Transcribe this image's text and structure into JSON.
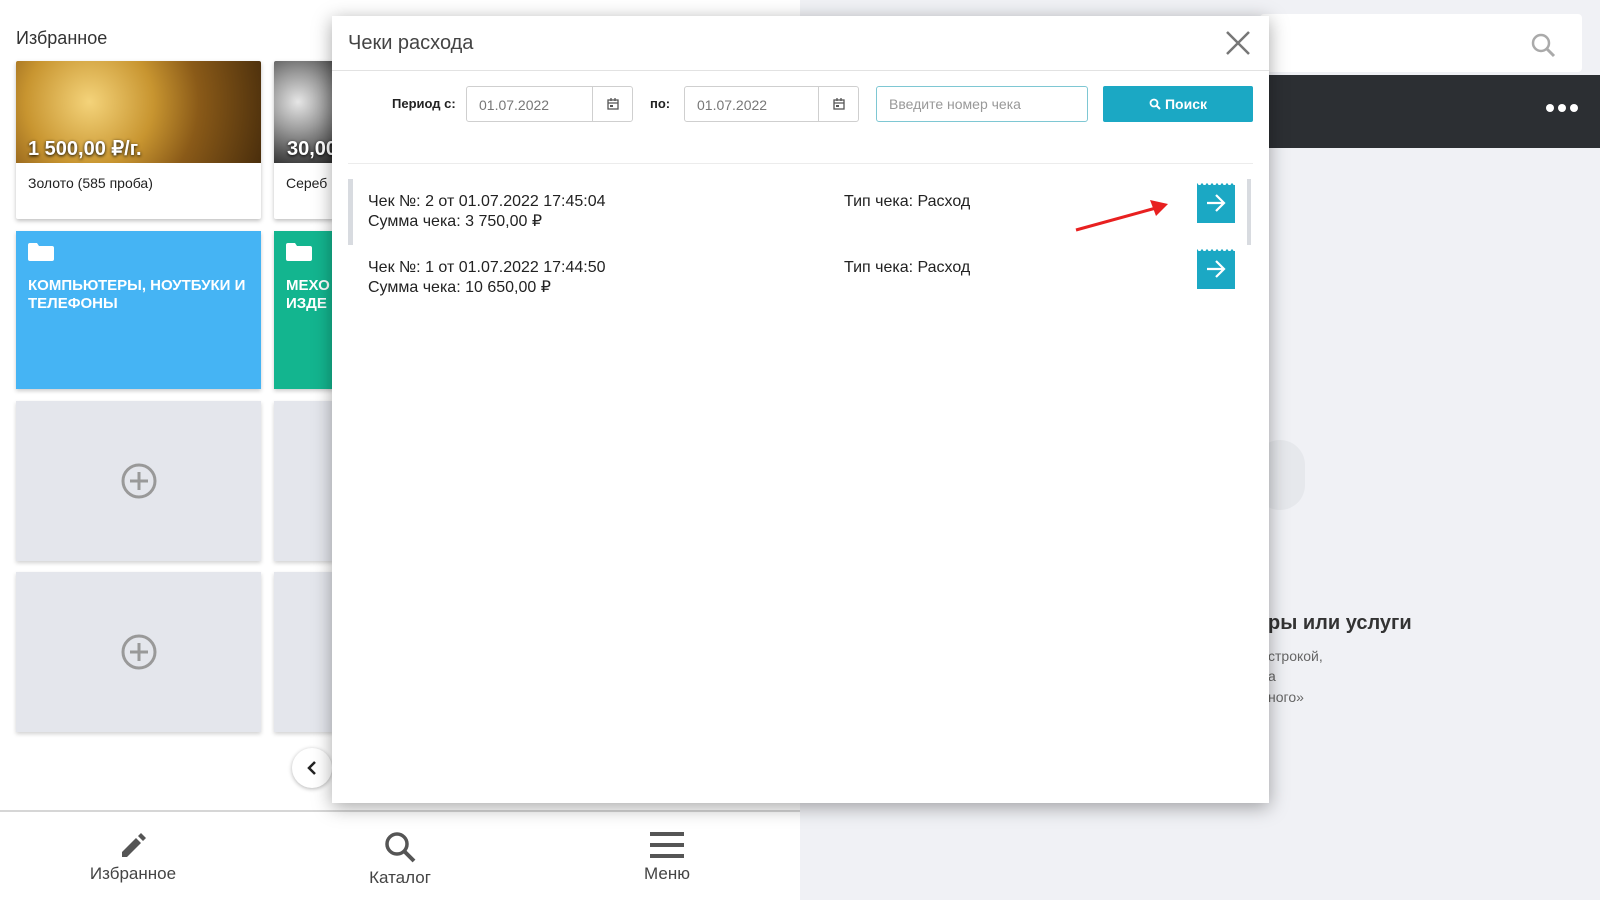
{
  "favorites": {
    "title": "Избранное",
    "products": [
      {
        "price": "1 500,00 ₽/г.",
        "name": "Золото (585 проба)"
      },
      {
        "price": "30,00",
        "name": "Сереб"
      }
    ],
    "categories": [
      {
        "label": "КОМПЬЮТЕРЫ, НОУТБУКИ И ТЕЛЕФОНЫ",
        "color": "#45b4f4"
      },
      {
        "label": "МЕХО ИЗДЕ",
        "color": "#13b58f"
      }
    ]
  },
  "bottom_nav": [
    {
      "label": "Избранное",
      "icon": "pencil-icon"
    },
    {
      "label": "Каталог",
      "icon": "search-icon"
    },
    {
      "label": "Меню",
      "icon": "hamburger-icon"
    }
  ],
  "right_panel": {
    "empty_title": "ры или услуги",
    "hint_lines": [
      "строкой,",
      "а",
      "ного»"
    ]
  },
  "modal": {
    "title": "Чеки расхода",
    "period_from_label": "Период с:",
    "date_from": "01.07.2022",
    "period_to_label": "по:",
    "date_to": "01.07.2022",
    "receipt_placeholder": "Введите номер чека",
    "search_label": "Поиск",
    "receipts": [
      {
        "title": "Чек №: 2 от 01.07.2022 17:45:04",
        "sum": "Сумма чека: 3 750,00 ₽",
        "type": "Тип чека: Расход"
      },
      {
        "title": "Чек №: 1 от 01.07.2022 17:44:50",
        "sum": "Сумма чека: 10 650,00 ₽",
        "type": "Тип чека: Расход"
      }
    ]
  },
  "colors": {
    "accent": "#1ba8c4",
    "annotation": "#e82020"
  }
}
